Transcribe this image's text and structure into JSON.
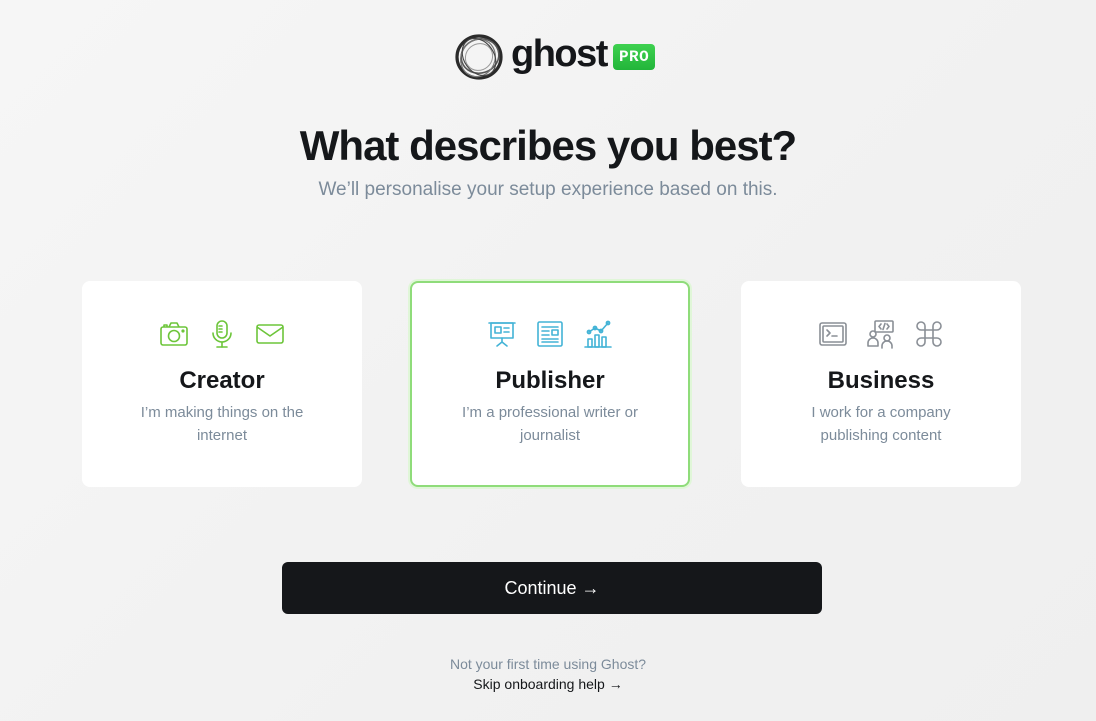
{
  "brand": {
    "name": "ghost",
    "badge": "PRO",
    "badge_color": "#30cf43"
  },
  "header": {
    "title": "What describes you best?",
    "subtitle": "We’ll personalise your setup experience based on this."
  },
  "options": [
    {
      "title": "Creator",
      "description": "I’m making things on the internet",
      "icons": [
        "camera-icon",
        "microphone-icon",
        "mail-icon"
      ],
      "icon_color": "#6dc53a",
      "selected": false
    },
    {
      "title": "Publisher",
      "description": "I’m a professional writer or journalist",
      "icons": [
        "presentation-icon",
        "newspaper-icon",
        "analytics-icon"
      ],
      "icon_color": "#43b3d6",
      "selected": true
    },
    {
      "title": "Business",
      "description": "I work for a company publishing content",
      "icons": [
        "terminal-icon",
        "team-code-icon",
        "command-icon"
      ],
      "icon_color": "#8a8f96",
      "selected": false
    }
  ],
  "actions": {
    "continue_label": "Continue →"
  },
  "footer": {
    "question": "Not your first time using Ghost?",
    "skip_label": "Skip onboarding help →"
  },
  "colors": {
    "selected_border": "#8fdc7a",
    "button_bg": "#15171a",
    "muted_text": "#7c8b9a"
  }
}
